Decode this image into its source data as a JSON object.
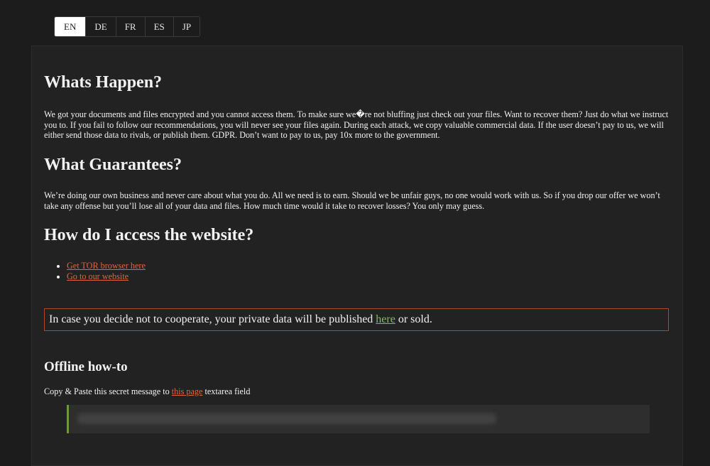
{
  "languages": [
    {
      "label": "EN",
      "active": true
    },
    {
      "label": "DE",
      "active": false
    },
    {
      "label": "FR",
      "active": false
    },
    {
      "label": "ES",
      "active": false
    },
    {
      "label": "JP",
      "active": false
    }
  ],
  "sections": {
    "happen": {
      "heading": "Whats Happen?",
      "text": "We got your documents and files encrypted and you cannot access them. To make sure we�re not bluffing just check out your files. Want to recover them? Just do what we instruct you to. If you fail to follow our recommendations, you will never see your files again. During each attack, we copy valuable commercial data. If the user doesn’t pay to us, we will either send those data to rivals, or publish them. GDPR. Don’t want to pay to us, pay 10x more to the government."
    },
    "guarantees": {
      "heading": "What Guarantees?",
      "text": "We’re doing our own business and never care about what you do. All we need is to earn. Should we be unfair guys, no one would work with us. So if you drop our offer we won’t take any offense but you’ll lose all of your data and files. How much time would it take to recover losses? You only may guess."
    },
    "access": {
      "heading": "How do I access the website?",
      "links": [
        "Get TOR browser here",
        "Go to our website"
      ]
    },
    "warning": {
      "before": "In case you decide not to cooperate, your private data will be published ",
      "link": "here",
      "after": " or sold."
    },
    "offline": {
      "heading": "Offline how-to",
      "before": "Copy & Paste this secret message to ",
      "link": "this page",
      "after": " textarea field"
    }
  },
  "colors": {
    "link_orange": "#e0663c",
    "link_green": "#7cbf5c",
    "warning_border": "#a8472a",
    "secret_accent": "#6a9a3c"
  }
}
